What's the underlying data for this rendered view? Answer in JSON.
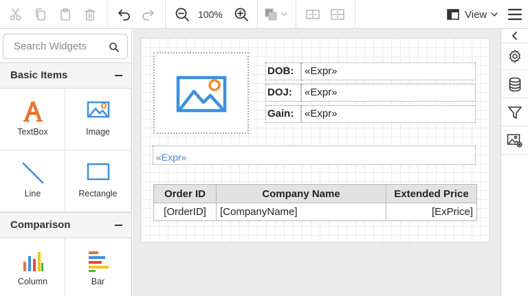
{
  "toolbar": {
    "zoom_level": "100%",
    "view_label": "View",
    "icons": [
      "scissors-icon",
      "copy-icon",
      "paste-icon",
      "delete-icon",
      "undo-icon",
      "redo-icon",
      "zoom-out-icon",
      "zoom-in-icon",
      "fill-color-icon",
      "align-horizontal-icon",
      "align-vertical-icon",
      "view-icon",
      "menu-icon"
    ]
  },
  "sidebar": {
    "search_placeholder": "Search Widgets",
    "categories": [
      {
        "title": "Basic Items",
        "items": [
          {
            "label": "TextBox",
            "icon": "textbox-icon"
          },
          {
            "label": "Image",
            "icon": "image-icon"
          },
          {
            "label": "Line",
            "icon": "line-icon"
          },
          {
            "label": "Rectangle",
            "icon": "rectangle-icon"
          }
        ]
      },
      {
        "title": "Comparison",
        "items": [
          {
            "label": "Column",
            "icon": "column-chart-icon"
          },
          {
            "label": "Bar",
            "icon": "bar-chart-icon"
          }
        ]
      }
    ]
  },
  "right_panel": {
    "buttons": [
      "collapse-chevron-icon",
      "settings-gear-icon",
      "database-icon",
      "filter-icon",
      "image-settings-icon"
    ]
  },
  "report": {
    "fields": [
      {
        "label": "DOB:",
        "value": "«Expr»"
      },
      {
        "label": "DOJ:",
        "value": "«Expr»"
      },
      {
        "label": "Gain:",
        "value": "«Expr»"
      }
    ],
    "expression_band": "«Expr»",
    "table": {
      "headers": [
        "Order ID",
        "Company Name",
        "Extended Price"
      ],
      "row": [
        "[OrderID]",
        "[CompanyName]",
        "[ExPrice]"
      ]
    }
  },
  "colors": {
    "accent_blue": "#3d8fe0",
    "image_sun": "#f28a2a",
    "textbox_icon": "#e8762c",
    "expr_text": "#4a86d9"
  }
}
